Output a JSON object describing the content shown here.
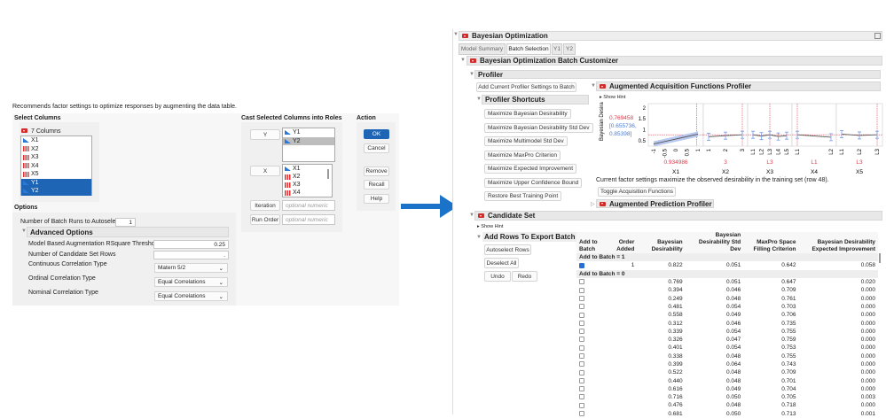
{
  "dialog": {
    "description": "Recommends factor settings to optimize responses by augmenting the data table.",
    "select_columns_label": "Select Columns",
    "columns_count": "7 Columns",
    "columns": [
      {
        "name": "X1",
        "type": "continuous"
      },
      {
        "name": "X2",
        "type": "nominal"
      },
      {
        "name": "X3",
        "type": "nominal"
      },
      {
        "name": "X4",
        "type": "nominal"
      },
      {
        "name": "X5",
        "type": "nominal"
      },
      {
        "name": "Y1",
        "type": "continuous",
        "selected": true
      },
      {
        "name": "Y2",
        "type": "continuous",
        "selected": true
      }
    ],
    "cast_label": "Cast Selected Columns into Roles",
    "roles": {
      "y_button": "Y",
      "y_list": [
        "Y1",
        "Y2"
      ],
      "x_button": "X",
      "x_list": [
        "X1",
        "X2",
        "X3",
        "X4"
      ],
      "iteration_button": "Iteration",
      "iteration_placeholder": "optional numeric",
      "run_order_button": "Run Order",
      "run_order_placeholder": "optional numeric"
    },
    "action_label": "Action",
    "actions": {
      "ok": "OK",
      "cancel": "Cancel",
      "remove": "Remove",
      "recall": "Recall",
      "help": "Help"
    },
    "options_label": "Options",
    "batch_runs_label": "Number of Batch Runs to Autoselect",
    "batch_runs_value": "1",
    "advanced_label": "Advanced Options",
    "rsquare_label": "Model Based Augmentation RSquare Threshold",
    "rsquare_value": "0.25",
    "candidate_rows_label": "Number of Candidate Set Rows",
    "candidate_rows_value": ".",
    "continuous_label": "Continuous Correlation Type",
    "continuous_value": "Matern 5/2",
    "ordinal_label": "Ordinal Correlation Type",
    "ordinal_value": "Equal Correlations",
    "nominal_label": "Nominal Correlation Type",
    "nominal_value": "Equal Correlations"
  },
  "report": {
    "title": "Bayesian Optimization",
    "tabs": [
      "Model Summary",
      "Batch Selection",
      "Y1",
      "Y2"
    ],
    "active_tab": "Batch Selection",
    "customizer_title": "Bayesian Optimization Batch Customizer",
    "profiler_title": "Profiler",
    "add_current_button": "Add Current Profiler Settings to Batch",
    "shortcuts_title": "Profiler Shortcuts",
    "shortcuts": [
      "Maximize Bayesian Desirability",
      "Maximize Bayesian Desirability Std Dev",
      "Maximize Multimodel Std Dev",
      "Maximize MaxPro Criterion",
      "Maximize Expected Improvement",
      "Maximize Upper Confidence Bound",
      "Restore Best Training Point"
    ],
    "acq_title": "Augmented Acquisition Functions Profiler",
    "show_hint": "Show Hint",
    "profiler": {
      "ylabel": "Bayesian Desirability",
      "value": "0.769458",
      "interval": "[0.655736,",
      "interval2": "0.85398]",
      "yticks": [
        "2",
        "1.5",
        "1",
        "0.5"
      ],
      "factors": [
        {
          "name": "X1",
          "ticks": [
            "-1",
            "-0.5",
            "0",
            "0.5",
            "1"
          ],
          "current": "0.934986",
          "curve": [
            0.35,
            0.8
          ]
        },
        {
          "name": "X2",
          "ticks": [
            "1",
            "2",
            "3"
          ],
          "current": "3",
          "curve": [
            0.68,
            0.73,
            0.77
          ]
        },
        {
          "name": "X3",
          "ticks": [
            "L1",
            "L2",
            "L3",
            "L4",
            "L5"
          ],
          "current": "L3",
          "curve": [
            0.77,
            0.71,
            0.77,
            0.69,
            0.73
          ]
        },
        {
          "name": "X4",
          "ticks": [
            "L1",
            "L2"
          ],
          "current": "L1",
          "curve": [
            0.77,
            0.66
          ]
        },
        {
          "name": "X5",
          "ticks": [
            "L1",
            "L2",
            "L3"
          ],
          "current": "L3",
          "curve": [
            0.8,
            0.74,
            0.77
          ]
        }
      ]
    },
    "profiler_note": "Current factor settings maximize the observed desirability in the training set (row 48).",
    "toggle_button": "Toggle Acquisition Functions",
    "prediction_title": "Augmented Prediction Profiler",
    "candidate_title": "Candidate Set",
    "candidate_hint": "Show Hint",
    "export_title": "Add Rows To Export Batch",
    "export_buttons": {
      "autoselect": "Autoselect Rows",
      "deselect": "Deselect All",
      "undo": "Undo",
      "redo": "Redo"
    },
    "table": {
      "headers": [
        "Add to Batch",
        "Order Added",
        "Bayesian Desirability",
        "Bayesian Desirability Std Dev",
        "MaxPro Space Filling Criterion",
        "Bayesian Desirability Expected Improvement"
      ],
      "group1": "Add to Batch = 1",
      "group0": "Add to Batch = 0",
      "selected_rows": [
        [
          "1",
          "0.822",
          "0.051",
          "0.642",
          "0.058"
        ]
      ],
      "rows": [
        [
          "0.769",
          "0.051",
          "0.647",
          "0.020"
        ],
        [
          "0.394",
          "0.046",
          "0.709",
          "0.000"
        ],
        [
          "0.249",
          "0.048",
          "0.761",
          "0.000"
        ],
        [
          "0.481",
          "0.054",
          "0.703",
          "0.000"
        ],
        [
          "0.558",
          "0.049",
          "0.706",
          "0.000"
        ],
        [
          "0.312",
          "0.046",
          "0.735",
          "0.000"
        ],
        [
          "0.339",
          "0.054",
          "0.755",
          "0.000"
        ],
        [
          "0.326",
          "0.047",
          "0.759",
          "0.000"
        ],
        [
          "0.401",
          "0.054",
          "0.753",
          "0.000"
        ],
        [
          "0.338",
          "0.048",
          "0.755",
          "0.000"
        ],
        [
          "0.399",
          "0.064",
          "0.743",
          "0.000"
        ],
        [
          "0.522",
          "0.048",
          "0.709",
          "0.000"
        ],
        [
          "0.440",
          "0.048",
          "0.701",
          "0.000"
        ],
        [
          "0.616",
          "0.049",
          "0.704",
          "0.000"
        ],
        [
          "0.716",
          "0.050",
          "0.705",
          "0.003"
        ],
        [
          "0.476",
          "0.048",
          "0.718",
          "0.000"
        ],
        [
          "0.681",
          "0.050",
          "0.713",
          "0.001"
        ]
      ]
    }
  },
  "colors": {
    "accent": "#1f65b5",
    "arrow": "#1a73c8",
    "current_value": "#e0394a",
    "interval": "#4a7bd8"
  }
}
